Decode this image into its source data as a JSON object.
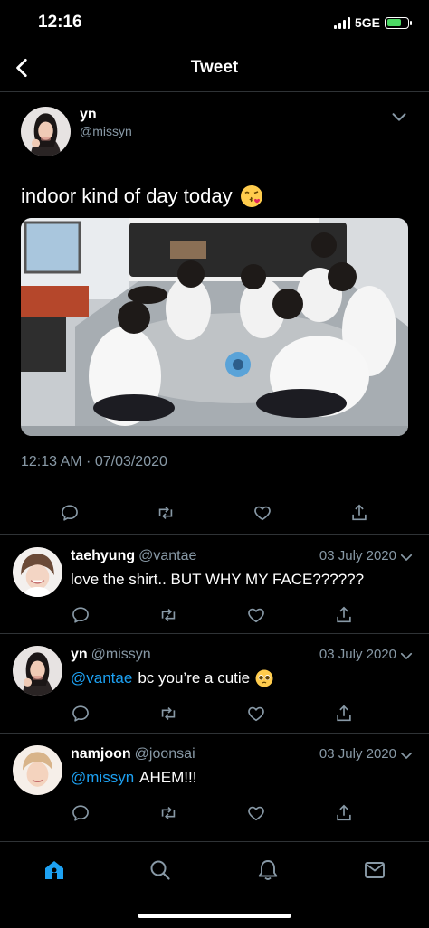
{
  "status_bar": {
    "time": "12:16",
    "network": "5GE"
  },
  "nav": {
    "title": "Tweet"
  },
  "main_tweet": {
    "display_name": "yn",
    "handle": "@missyn",
    "text": "indoor kind of day today",
    "timestamp": "12:13 AM · 07/03/2020"
  },
  "replies": [
    {
      "name": "taehyung",
      "handle": "@vantae",
      "date": "03 July 2020",
      "mention": "",
      "text": "love the shirt.. BUT WHY MY FACE??????"
    },
    {
      "name": "yn",
      "handle": "@missyn",
      "date": "03 July 2020",
      "mention": "@vantae",
      "text": "bc you’re a cutie"
    },
    {
      "name": "namjoon",
      "handle": "@joonsai",
      "date": "03 July 2020",
      "mention": "@missyn",
      "text": "AHEM!!!"
    }
  ],
  "colors": {
    "accent": "#1da1f2",
    "muted": "#8899a6",
    "separator": "#2f3336",
    "battery": "#4cd964"
  },
  "icons": [
    "back-chevron-icon",
    "chevron-down-icon",
    "reply-icon",
    "retweet-icon",
    "like-icon",
    "share-icon",
    "home-icon",
    "search-icon",
    "notifications-icon",
    "messages-icon"
  ]
}
